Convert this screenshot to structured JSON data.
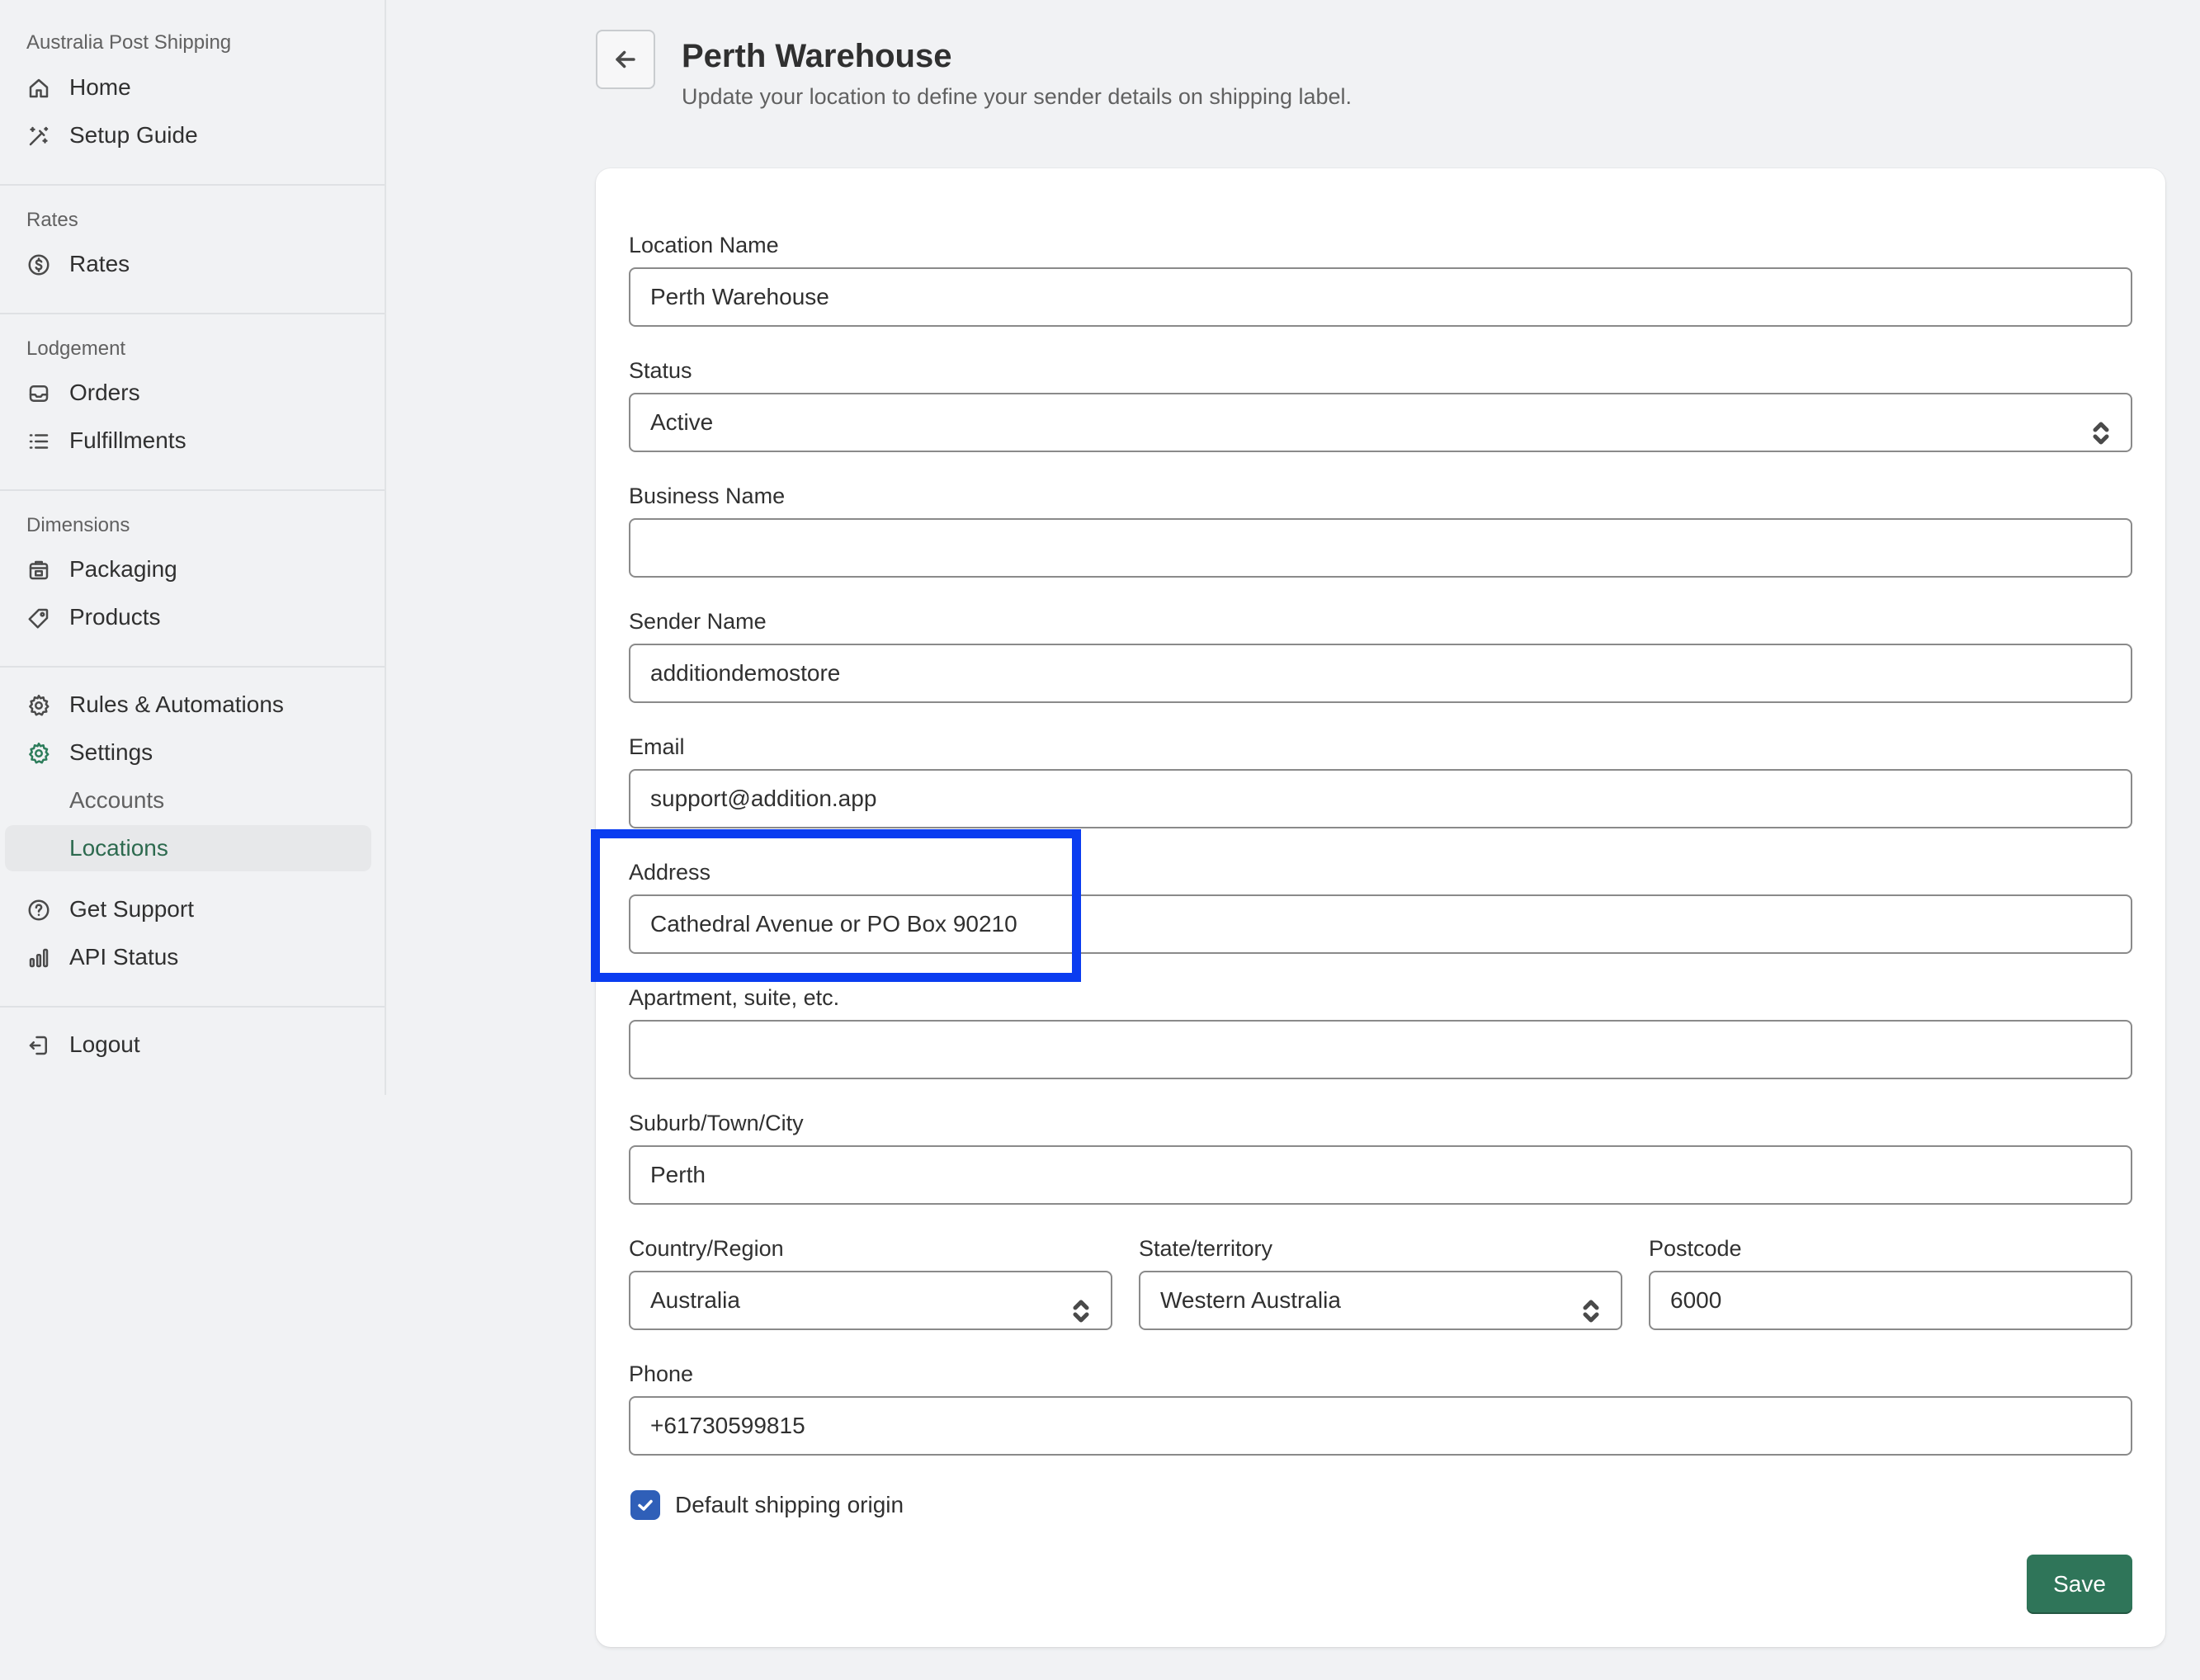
{
  "app": {
    "name": "Australia Post Shipping"
  },
  "sidebar": {
    "home": "Home",
    "setup_guide": "Setup Guide",
    "rates_section": "Rates",
    "rates": "Rates",
    "lodgement_section": "Lodgement",
    "orders": "Orders",
    "fulfillments": "Fulfillments",
    "dimensions_section": "Dimensions",
    "packaging": "Packaging",
    "products": "Products",
    "rules_automations": "Rules & Automations",
    "settings": "Settings",
    "accounts": "Accounts",
    "locations": "Locations",
    "get_support": "Get Support",
    "api_status": "API Status",
    "logout": "Logout"
  },
  "header": {
    "title": "Perth Warehouse",
    "subtitle": "Update your location to define your sender details on shipping label."
  },
  "form": {
    "location_name": {
      "label": "Location Name",
      "value": "Perth Warehouse"
    },
    "status": {
      "label": "Status",
      "value": "Active"
    },
    "business_name": {
      "label": "Business Name",
      "value": ""
    },
    "sender_name": {
      "label": "Sender Name",
      "value": "additiondemostore"
    },
    "email": {
      "label": "Email",
      "value": "support@addition.app"
    },
    "address": {
      "label": "Address",
      "value": "Cathedral Avenue or PO Box 90210"
    },
    "apartment": {
      "label": "Apartment, suite, etc.",
      "value": ""
    },
    "suburb": {
      "label": "Suburb/Town/City",
      "value": "Perth"
    },
    "country": {
      "label": "Country/Region",
      "value": "Australia"
    },
    "state": {
      "label": "State/territory",
      "value": "Western Australia"
    },
    "postcode": {
      "label": "Postcode",
      "value": "6000"
    },
    "phone": {
      "label": "Phone",
      "value": "+61730599815"
    },
    "default_origin": {
      "label": "Default shipping origin",
      "checked": true
    },
    "save_label": "Save"
  },
  "colors": {
    "accent_green": "#2f7559",
    "highlight_blue": "#0a3cf0",
    "checkbox_blue": "#2f5fb8"
  },
  "icons": {
    "home": "home-icon",
    "setup_guide": "magic-wand-icon",
    "rates": "dollar-circle-icon",
    "orders": "inbox-icon",
    "fulfillments": "list-icon",
    "packaging": "package-icon",
    "products": "tag-icon",
    "rules": "gear-icon",
    "settings": "gear-icon",
    "support": "question-circle-icon",
    "api_status": "bar-chart-icon",
    "logout": "exit-icon",
    "back": "arrow-left-icon"
  }
}
